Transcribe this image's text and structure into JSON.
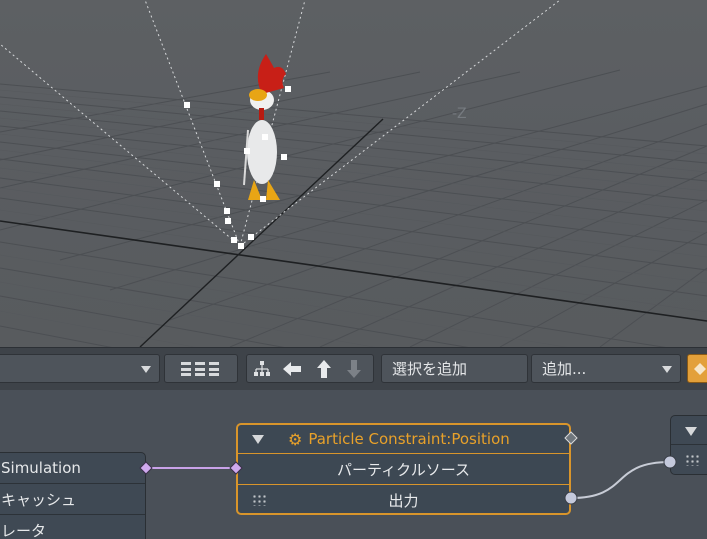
{
  "viewport": {
    "axis_label": "-Z"
  },
  "toolbar": {
    "dropdown_left_value": "",
    "layout_icon": "grid-layout-icon",
    "icons": [
      "hierarchy-icon",
      "arrow-left-icon",
      "arrow-up-icon",
      "arrow-down-icon"
    ],
    "add_selection_label": "選択を追加",
    "add_dropdown_value": "追加...",
    "accent_color": "#e3a03a"
  },
  "graph": {
    "main_node": {
      "title": "Particle Constraint:Position",
      "input_label": "パーティクルソース",
      "output_label": "出力",
      "border_color": "#d9952b"
    },
    "left_node": {
      "rows": [
        "Simulation",
        "キャッシュ",
        "レータ"
      ]
    },
    "wire_color_input": "#c9a2e8",
    "wire_color_output": "#c8ccd6"
  }
}
